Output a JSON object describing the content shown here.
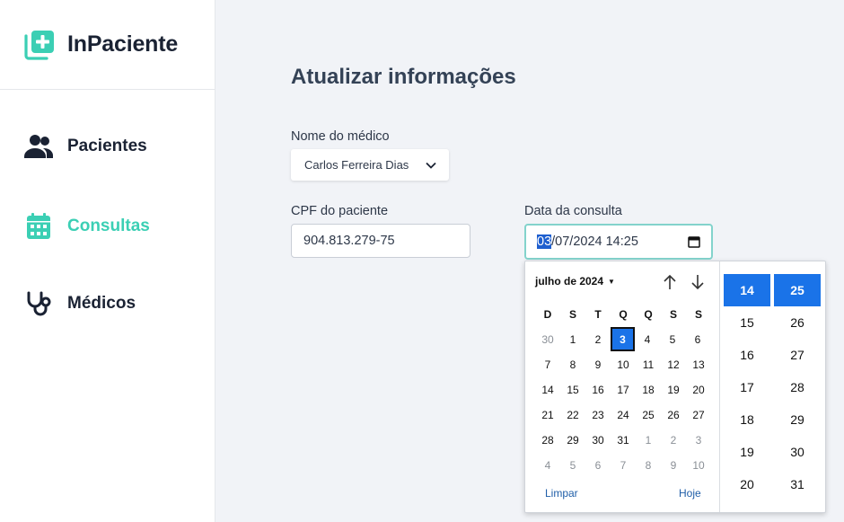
{
  "brand": {
    "name": "InPaciente"
  },
  "colors": {
    "accent": "#3bcfb4",
    "highlight": "#1a73e8"
  },
  "sidebar": {
    "items": [
      {
        "label": "Pacientes",
        "icon": "users-icon"
      },
      {
        "label": "Consultas",
        "icon": "calendar-icon",
        "active": true
      },
      {
        "label": "Médicos",
        "icon": "stethoscope-icon"
      }
    ]
  },
  "main": {
    "title": "Atualizar informações",
    "medico": {
      "label": "Nome do médico",
      "value": "Carlos Ferreira Dias"
    },
    "cpf": {
      "label": "CPF do paciente",
      "value": "904.813.279-75"
    },
    "data": {
      "label": "Data da consulta",
      "day": "03",
      "rest": "/07/2024 14:25"
    }
  },
  "picker": {
    "month_label": "julho de 2024",
    "weekdays": [
      "D",
      "S",
      "T",
      "Q",
      "Q",
      "S",
      "S"
    ],
    "weeks": [
      [
        {
          "d": "30",
          "o": true
        },
        {
          "d": "1"
        },
        {
          "d": "2"
        },
        {
          "d": "3",
          "s": true
        },
        {
          "d": "4"
        },
        {
          "d": "5"
        },
        {
          "d": "6"
        }
      ],
      [
        {
          "d": "7"
        },
        {
          "d": "8"
        },
        {
          "d": "9"
        },
        {
          "d": "10"
        },
        {
          "d": "11"
        },
        {
          "d": "12"
        },
        {
          "d": "13"
        }
      ],
      [
        {
          "d": "14"
        },
        {
          "d": "15"
        },
        {
          "d": "16"
        },
        {
          "d": "17"
        },
        {
          "d": "18"
        },
        {
          "d": "19"
        },
        {
          "d": "20"
        }
      ],
      [
        {
          "d": "21"
        },
        {
          "d": "22"
        },
        {
          "d": "23"
        },
        {
          "d": "24"
        },
        {
          "d": "25"
        },
        {
          "d": "26"
        },
        {
          "d": "27"
        }
      ],
      [
        {
          "d": "28"
        },
        {
          "d": "29"
        },
        {
          "d": "30"
        },
        {
          "d": "31"
        },
        {
          "d": "1",
          "o": true
        },
        {
          "d": "2",
          "o": true
        },
        {
          "d": "3",
          "o": true
        }
      ],
      [
        {
          "d": "4",
          "o": true
        },
        {
          "d": "5",
          "o": true
        },
        {
          "d": "6",
          "o": true
        },
        {
          "d": "7",
          "o": true
        },
        {
          "d": "8",
          "o": true
        },
        {
          "d": "9",
          "o": true
        },
        {
          "d": "10",
          "o": true
        }
      ]
    ],
    "clear_label": "Limpar",
    "today_label": "Hoje",
    "hours": [
      "14",
      "15",
      "16",
      "17",
      "18",
      "19",
      "20"
    ],
    "minutes": [
      "25",
      "26",
      "27",
      "28",
      "29",
      "30",
      "31"
    ],
    "selected_hour": "14",
    "selected_minute": "25"
  }
}
